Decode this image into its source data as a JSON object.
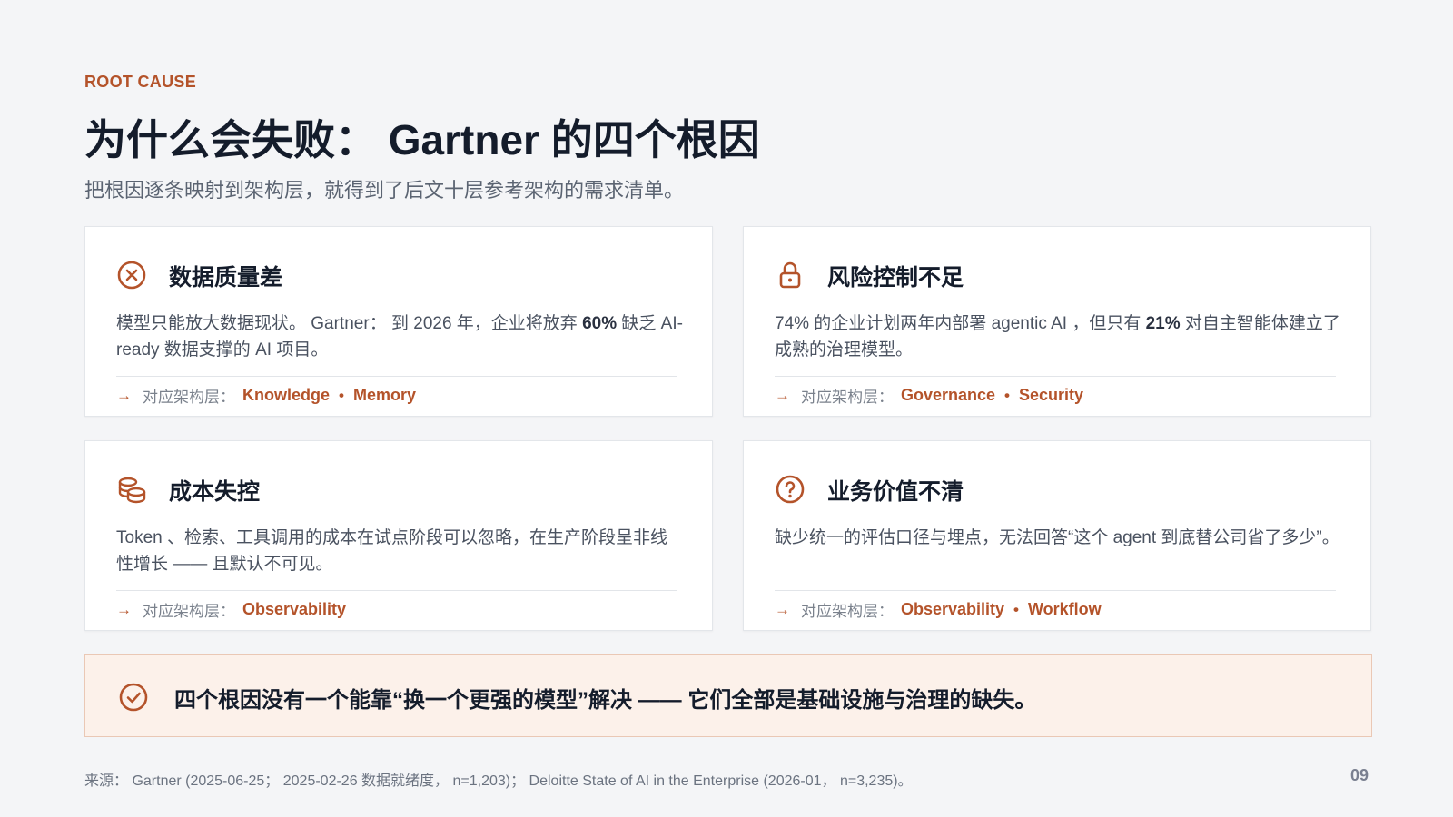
{
  "header": {
    "eyebrow": "ROOT CAUSE",
    "title": "为什么会失败： Gartner 的四个根因",
    "subtitle": "把根因逐条映射到架构层，就得到了后文十层参考架构的需求清单。"
  },
  "layer_prefix": "对应架构层：",
  "cards": [
    {
      "icon": "x-circle-icon",
      "title": "数据质量差",
      "body_parts": [
        "模型只能放大数据现状。 Gartner： 到 2026 年，企业将放弃 ",
        "60%",
        " 缺乏 AI-ready 数据支撑的 AI 项目。"
      ],
      "layers": [
        "Knowledge",
        "Memory"
      ]
    },
    {
      "icon": "lock-icon",
      "title": "风险控制不足",
      "body_parts": [
        "74% 的企业计划两年内部署 agentic AI ，但只有 ",
        "21%",
        " 对自主智能体建立了成熟的治理模型。"
      ],
      "layers": [
        "Governance",
        "Security"
      ]
    },
    {
      "icon": "coins-icon",
      "title": "成本失控",
      "body_parts": [
        "Token 、检索、工具调用的成本在试点阶段可以忽略，在生产阶段呈非线性增长 —— 且默认不可见。",
        "",
        ""
      ],
      "layers": [
        "Observability"
      ]
    },
    {
      "icon": "question-circle-icon",
      "title": "业务价值不清",
      "body_parts": [
        "缺少统一的评估口径与埋点，无法回答“这个 agent 到底替公司省了多少”。",
        "",
        ""
      ],
      "layers": [
        "Observability",
        "Workflow"
      ]
    }
  ],
  "callout": {
    "icon": "check-circle-icon",
    "text": "四个根因没有一个能靠“换一个更强的模型”解决 —— 它们全部是基础设施与治理的缺失。"
  },
  "footer": {
    "source": "来源： Gartner (2025-06-25； 2025-02-26 数据就绪度， n=1,203)； Deloitte State of AI in the Enterprise (2026-01， n=3,235)。",
    "page_number": "09"
  },
  "colors": {
    "accent": "#b4532a",
    "title": "#141c2b",
    "callout_bg": "#fcf1ea"
  }
}
